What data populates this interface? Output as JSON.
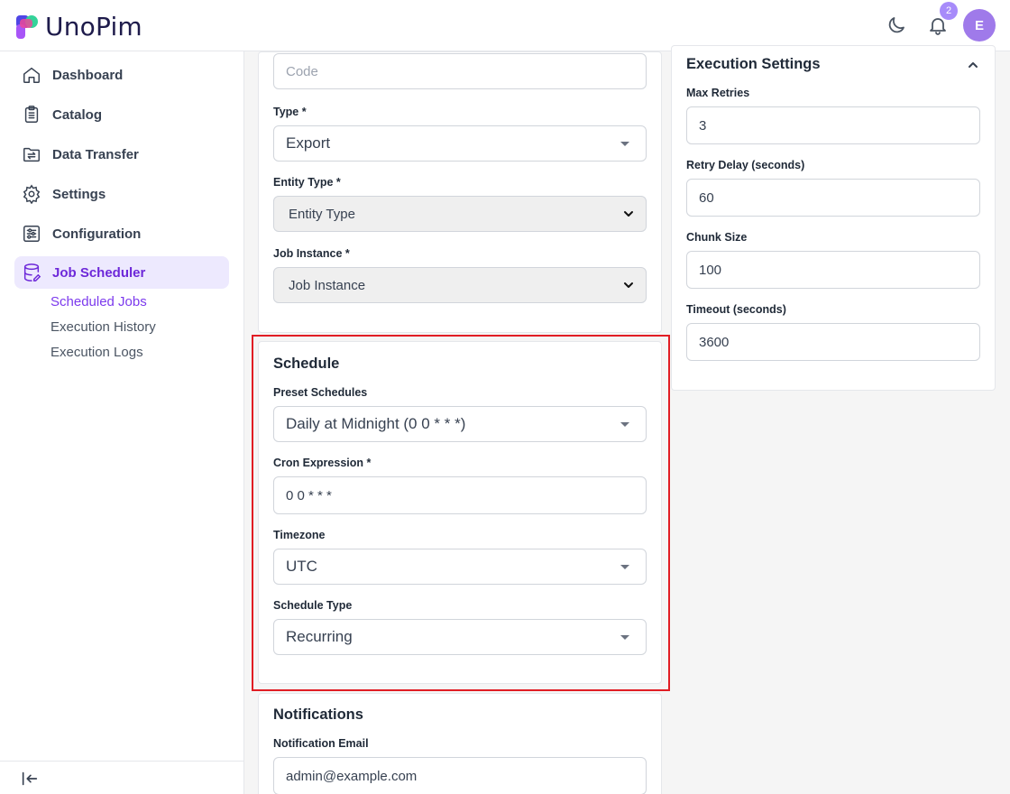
{
  "header": {
    "logo_text": "UnoPim",
    "notification_count": "2",
    "avatar_initial": "E"
  },
  "sidebar": {
    "items": [
      {
        "label": "Dashboard",
        "icon": "home-icon"
      },
      {
        "label": "Catalog",
        "icon": "clipboard-list-icon"
      },
      {
        "label": "Data Transfer",
        "icon": "folder-transfer-icon"
      },
      {
        "label": "Settings",
        "icon": "gear-icon"
      },
      {
        "label": "Configuration",
        "icon": "sliders-icon"
      },
      {
        "label": "Job Scheduler",
        "icon": "database-icon",
        "active": true
      }
    ],
    "sub_items": [
      {
        "label": "Scheduled Jobs",
        "active": true
      },
      {
        "label": "Execution History"
      },
      {
        "label": "Execution Logs"
      }
    ]
  },
  "general": {
    "code_placeholder": "Code",
    "type_label": "Type *",
    "type_value": "Export",
    "entity_type_label": "Entity Type *",
    "entity_type_value": "Entity Type",
    "job_instance_label": "Job Instance *",
    "job_instance_value": "Job Instance"
  },
  "schedule": {
    "title": "Schedule",
    "preset_label": "Preset Schedules",
    "preset_value": "Daily at Midnight (0 0 * * *)",
    "cron_label": "Cron Expression *",
    "cron_value": "0 0 * * *",
    "timezone_label": "Timezone",
    "timezone_value": "UTC",
    "schedule_type_label": "Schedule Type",
    "schedule_type_value": "Recurring"
  },
  "notifications": {
    "title": "Notifications",
    "email_label": "Notification Email",
    "email_value": "admin@example.com"
  },
  "execution": {
    "title": "Execution Settings",
    "max_retries_label": "Max Retries",
    "max_retries_value": "3",
    "retry_delay_label": "Retry Delay (seconds)",
    "retry_delay_value": "60",
    "chunk_size_label": "Chunk Size",
    "chunk_size_value": "100",
    "timeout_label": "Timeout (seconds)",
    "timeout_value": "3600"
  },
  "colors": {
    "accent": "#7c3aed",
    "active_bg": "#ede9fe",
    "highlight": "#e11d24"
  }
}
